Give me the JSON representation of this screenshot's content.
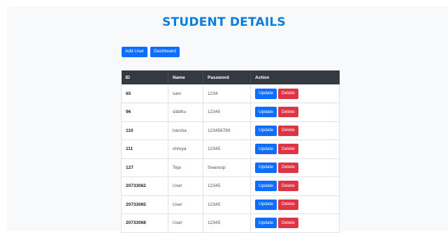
{
  "title": "STUDENT DETAILS",
  "toolbar": {
    "add_user_label": "Add User",
    "dashboard_label": "Dashboard"
  },
  "table": {
    "headers": {
      "id": "ID",
      "name": "Name",
      "password": "Password",
      "action": "Action"
    },
    "rows": [
      {
        "id": "65",
        "name": "sam",
        "password": "1234"
      },
      {
        "id": "96",
        "name": "siddhu",
        "password": "12345"
      },
      {
        "id": "110",
        "name": "harsha",
        "password": "123456789"
      },
      {
        "id": "111",
        "name": "shreya",
        "password": "12345"
      },
      {
        "id": "127",
        "name": "Teja",
        "password": "Swaroop"
      },
      {
        "id": "20733062",
        "name": "User",
        "password": "12345"
      },
      {
        "id": "20733065",
        "name": "User",
        "password": "12345"
      },
      {
        "id": "20733068",
        "name": "User",
        "password": "12345"
      }
    ],
    "update_label": "Update",
    "delete_label": "Delete"
  },
  "colors": {
    "title": "#0b7ed9",
    "primary": "#0d6efd",
    "danger": "#dc3545",
    "header_bg": "#343a40",
    "page_bg": "#f8f9fa"
  }
}
